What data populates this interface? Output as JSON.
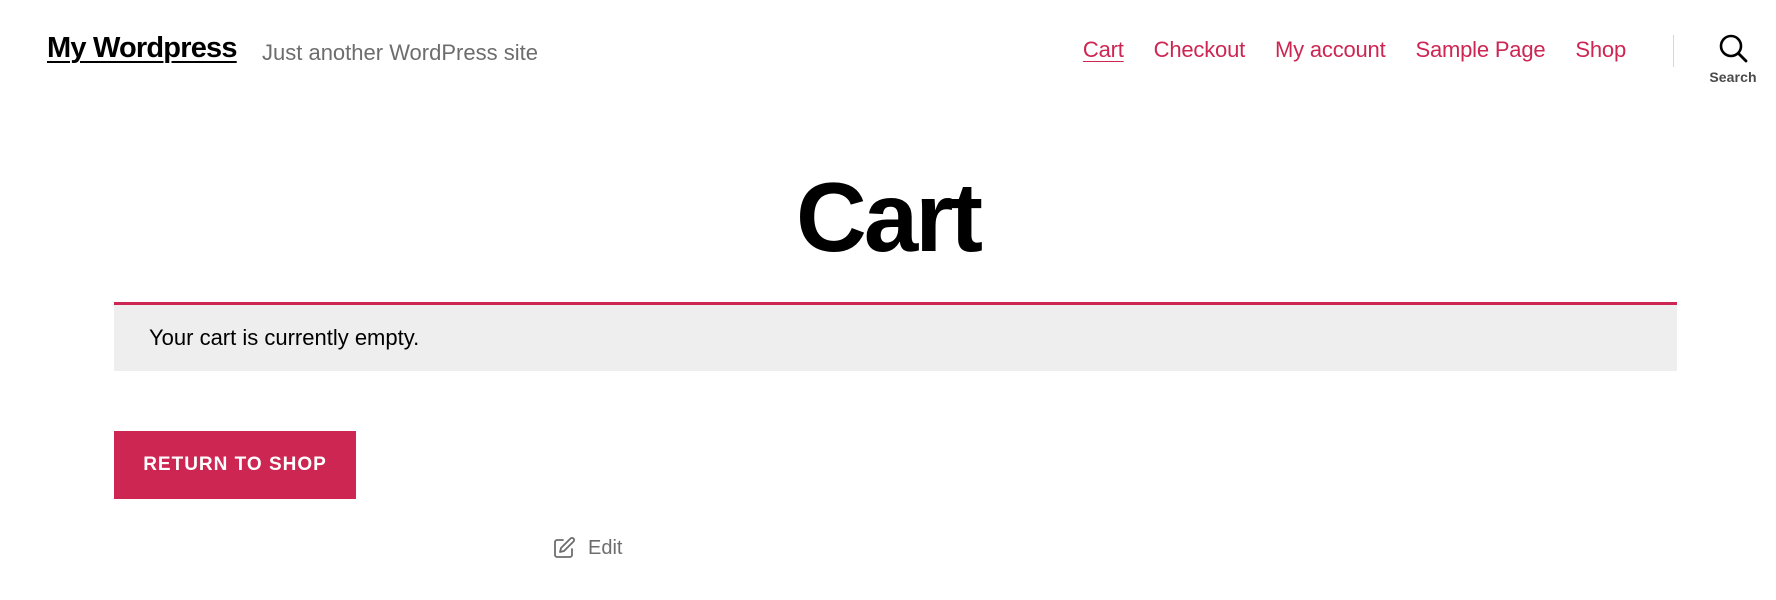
{
  "header": {
    "site_title": "My Wordpress",
    "site_description": "Just another WordPress site",
    "nav": [
      {
        "label": "Cart",
        "current": true
      },
      {
        "label": "Checkout"
      },
      {
        "label": "My account"
      },
      {
        "label": "Sample Page"
      },
      {
        "label": "Shop"
      }
    ],
    "search": {
      "label": "Search",
      "icon": "search-icon"
    }
  },
  "main": {
    "title": "Cart",
    "notice": "Your cart is currently empty.",
    "return_button": "Return to shop",
    "edit": {
      "label": "Edit",
      "icon": "edit-icon"
    }
  },
  "colors": {
    "accent": "#cd2653",
    "notice_background": "#eeeeee",
    "muted_text": "#6d6d6d"
  }
}
